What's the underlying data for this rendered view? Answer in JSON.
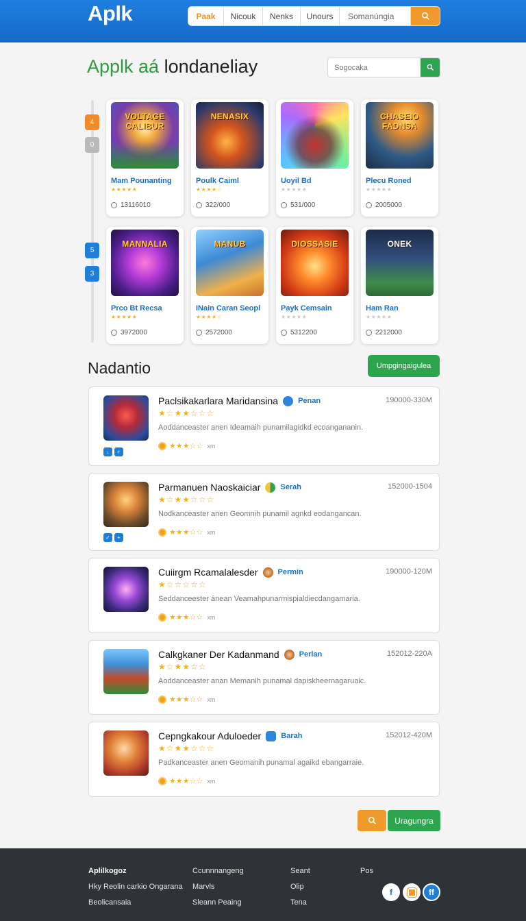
{
  "header": {
    "logo": "Aplk",
    "nav_tabs": [
      "Paak",
      "Nicouk",
      "Nenks",
      "Unours"
    ],
    "search_placeholder": "Somanúngia"
  },
  "hero": {
    "title_accent": "Applk aá",
    "title_rest": "londaneliay",
    "search_placeholder": "Sogocaka"
  },
  "rail": {
    "buttons": [
      "4",
      "0",
      "5",
      "3"
    ]
  },
  "games": [
    {
      "caption": "VOLTAGE CALIBUR",
      "name": "Mam Pounanting",
      "downloads": "13116010",
      "stars": "★★★★★"
    },
    {
      "caption": "NENASIX",
      "name": "Poulk Caiml",
      "downloads": "322/000",
      "stars": "★★★★☆"
    },
    {
      "caption": "",
      "name": "Uoyil Bd",
      "downloads": "531/000",
      "stars": "★★★★★"
    },
    {
      "caption": "CHASEIO FADNSA",
      "name": "Plecu Roned",
      "downloads": "2005000",
      "stars": "★★★★★"
    },
    {
      "caption": "MANNALIA",
      "name": "Prco Bt Recsa",
      "downloads": "3972000",
      "stars": "★★★★★"
    },
    {
      "caption": "MANUB",
      "name": "INain Caran Seopl",
      "downloads": "2572000",
      "stars": "★★★★☆"
    },
    {
      "caption": "DIOSSASIE",
      "name": "Payk Cemsain",
      "downloads": "5312200",
      "stars": "★★★★★"
    },
    {
      "caption": "ONEK",
      "name": "Ham Ran",
      "downloads": "2212000",
      "stars": "★★★★★"
    }
  ],
  "section": {
    "title": "Nadantio",
    "button": "Umpgingaigulea"
  },
  "reviews": [
    {
      "title": "Paclsikakarlara Maridansina",
      "badge": "Penan",
      "date": "190000-330M",
      "stars": "★☆★★☆☆☆",
      "desc": "Aoddanceaster anen Ideamaih punamilagidkd ecoangananin.",
      "rating": "★★★☆☆",
      "unit": "xm"
    },
    {
      "title": "Parmanuen Naoskaiciar",
      "badge": "Serah",
      "date": "152000-1504",
      "stars": "★☆★★☆☆☆",
      "desc": "Nodkanceaster anen Geomnih punamil agnkd eodangancan.",
      "rating": "★★★☆☆",
      "unit": "xm"
    },
    {
      "title": "Cuiirgm Rcamalalesder",
      "badge": "Permin",
      "date": "190000-120M",
      "stars": "★☆☆☆☆☆",
      "desc": "Seddanceester ánean Veamahpunarmispialdiecdangamaria.",
      "rating": "★★★☆☆",
      "unit": "xm"
    },
    {
      "title": "Calkgkaner Der Kadanmand",
      "badge": "Perlan",
      "date": "152012-220A",
      "stars": "★☆★★☆☆",
      "desc": "Aoddanceaster anan Memanih punamal dapiskheernagaruaic.",
      "rating": "★★★☆☆",
      "unit": "xm"
    },
    {
      "title": "Cepngkakour Aduloeder",
      "badge": "Barah",
      "date": "152012-420M",
      "stars": "★☆★★☆☆☆",
      "desc": "Padkanceaster anen Geomanih punamal agaikd ebangarraie.",
      "rating": "★★★☆☆",
      "unit": "xm"
    }
  ],
  "bottom": {
    "green_label": "Uragungra"
  },
  "footer": {
    "col1": [
      "Aplilkogoz",
      "Hky Reolin carkio Ongarana",
      "Beolicansaia"
    ],
    "col2": [
      "Ccunnnangeng",
      "Marvls",
      "Sleann Peaing"
    ],
    "col3": [
      "Seant",
      "Olip",
      "Tena"
    ],
    "col4": [
      "Pos"
    ]
  },
  "colors": {
    "brand_blue": "#1e7fe0",
    "accent_orange": "#ef9a2a",
    "accent_green": "#2da44e",
    "link_blue": "#1a6fc8",
    "star_gold": "#f2b319",
    "footer_bg": "#2f3338"
  },
  "icons": {
    "search": "search-icon",
    "facebook": "facebook-icon",
    "app": "app-icon",
    "ff": "ff-icon"
  }
}
